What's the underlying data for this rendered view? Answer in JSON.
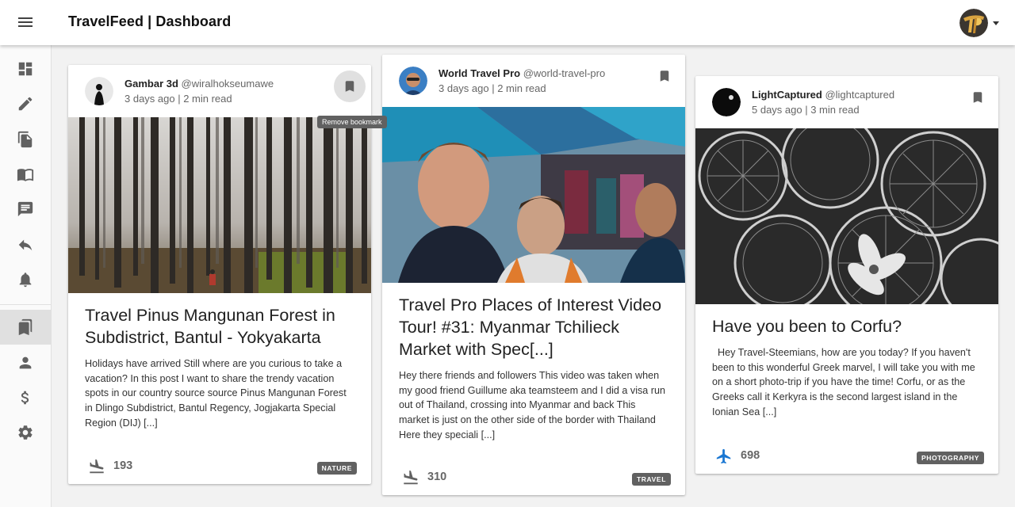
{
  "header": {
    "title": "TravelFeed | Dashboard",
    "menu_icon": "menu-icon",
    "avatar_icon": "user-avatar",
    "caret_icon": "caret-down-icon"
  },
  "sidebar": {
    "items": [
      {
        "icon": "dashboard-icon"
      },
      {
        "icon": "edit-icon"
      },
      {
        "icon": "drafts-icon"
      },
      {
        "icon": "posts-icon"
      },
      {
        "icon": "comments-icon"
      },
      {
        "icon": "replies-icon"
      },
      {
        "icon": "notifications-icon"
      },
      {
        "icon": "bookmarks-icon",
        "active": true
      },
      {
        "icon": "profile-icon"
      },
      {
        "icon": "wallet-icon"
      },
      {
        "icon": "settings-icon"
      }
    ]
  },
  "tooltip": "Remove bookmark",
  "cards": [
    {
      "author": "Gambar 3d",
      "handle": "@wiralhokseumawe",
      "meta": "3 days ago | 2 min read",
      "title": "Travel Pinus Mangunan Forest in Subdistrict, Bantul - Yokyakarta",
      "excerpt": "Holidays have arrived Still where are you curious to take a vacation? In this post I want to share the trendy vacation spots in our country source source Pinus Mangunan Forest in Dlingo Subdistrict, Bantul Regency, Jogjakarta Special Region (DIJ) [...]",
      "votes": "193",
      "tag": "NATURE",
      "voted": false
    },
    {
      "author": "World Travel Pro",
      "handle": "@world-travel-pro",
      "meta": "3 days ago | 2 min read",
      "title": "Travel Pro Places of Interest Video Tour! #31: Myanmar Tchilieck Market with Spec[...]",
      "excerpt": "Hey there friends and followers This video was taken when my good friend Guillume aka teamsteem and I did a visa run out of Thailand, crossing into Myanmar and back This market is just on the other side of the border with Thailand Here they speciali [...]",
      "votes": "310",
      "tag": "TRAVEL",
      "voted": false
    },
    {
      "author": "LightCaptured",
      "handle": "@lightcaptured",
      "meta": "5 days ago | 3 min read",
      "title": "Have you been to Corfu?",
      "excerpt": "  Hey Travel-Steemians, how are you today? If you haven't been to this wonderful Greek marvel, I will take you with me on a short photo-trip if you have the time! Corfu, or as the Greeks call it Kerkyra is the second largest island in the Ionian Sea [...]",
      "votes": "698",
      "tag": "PHOTOGRAPHY",
      "voted": true
    }
  ],
  "colors": {
    "accent_blue": "#1976d2",
    "icon_grey": "#616161",
    "chip_grey": "#616161"
  }
}
